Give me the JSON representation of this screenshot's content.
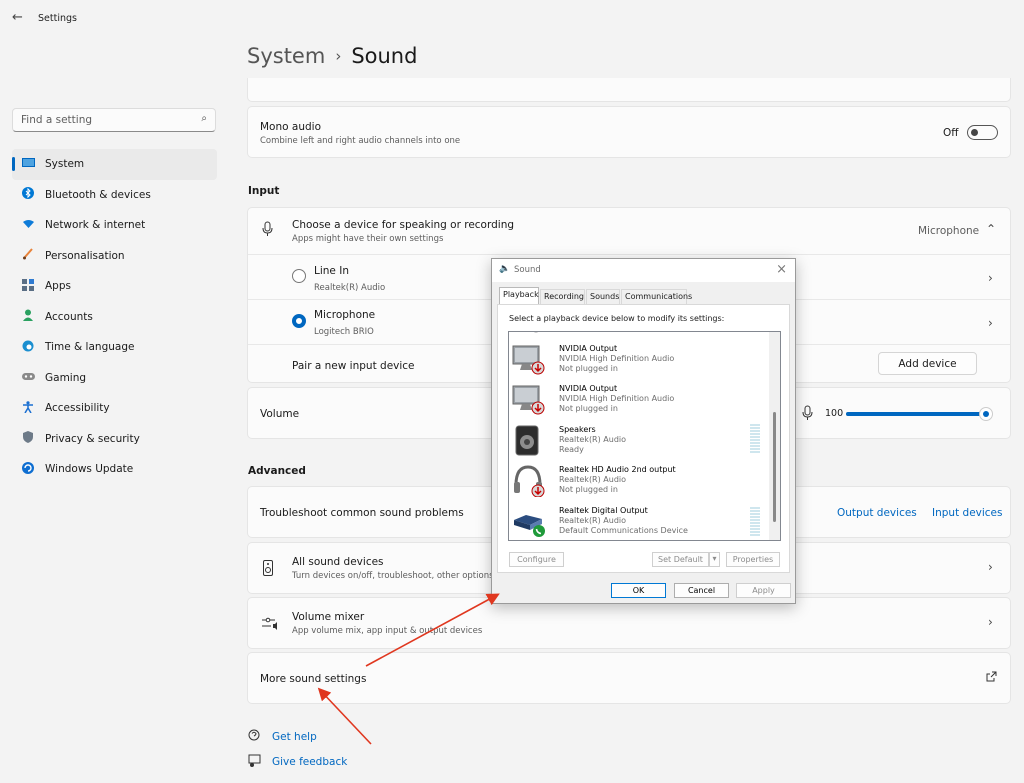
{
  "window": {
    "title": "Settings",
    "back_icon": "←"
  },
  "search": {
    "placeholder": "Find a setting",
    "icon": "search-icon"
  },
  "sidebar": {
    "items": [
      {
        "label": "System",
        "icon": "system-icon",
        "color": "#0067c0"
      },
      {
        "label": "Bluetooth & devices",
        "icon": "bluetooth-icon",
        "color": "#0078d4"
      },
      {
        "label": "Network & internet",
        "icon": "wifi-icon",
        "color": "#0e7bd8"
      },
      {
        "label": "Personalisation",
        "icon": "brush-icon",
        "color": "#e8833a"
      },
      {
        "label": "Apps",
        "icon": "apps-icon",
        "color": "#5a6e84"
      },
      {
        "label": "Accounts",
        "icon": "person-icon",
        "color": "#2aa160"
      },
      {
        "label": "Time & language",
        "icon": "globe-icon",
        "color": "#1b8fd0"
      },
      {
        "label": "Gaming",
        "icon": "gamepad-icon",
        "color": "#7a7a7a"
      },
      {
        "label": "Accessibility",
        "icon": "accessibility-icon",
        "color": "#1a6fd1"
      },
      {
        "label": "Privacy & security",
        "icon": "shield-icon",
        "color": "#6d7a88"
      },
      {
        "label": "Windows Update",
        "icon": "update-icon",
        "color": "#0e6ed1"
      }
    ]
  },
  "breadcrumb": {
    "parent": "System",
    "separator": "›",
    "current": "Sound"
  },
  "mono": {
    "title": "Mono audio",
    "subtitle": "Combine left and right audio channels into one",
    "state": "Off"
  },
  "input": {
    "heading": "Input",
    "choose_title": "Choose a device for speaking or recording",
    "choose_sub": "Apps might have their own settings",
    "selected_device": "Microphone",
    "devices": [
      {
        "name": "Line In",
        "detail": "Realtek(R) Audio",
        "selected": false
      },
      {
        "name": "Microphone",
        "detail": "Logitech BRIO",
        "selected": true
      }
    ],
    "pair_label": "Pair a new input device",
    "add_button": "Add device",
    "volume_label": "Volume",
    "volume_value": "100",
    "volume_level": 1.0
  },
  "advanced": {
    "heading": "Advanced",
    "troubleshoot": "Troubleshoot common sound problems",
    "output_link": "Output devices",
    "input_link": "Input devices",
    "all_devices_title": "All sound devices",
    "all_devices_sub": "Turn devices on/off, troubleshoot, other options",
    "mixer_title": "Volume mixer",
    "mixer_sub": "App volume mix, app input & output devices",
    "more_settings": "More sound settings"
  },
  "footer": {
    "help": "Get help",
    "feedback": "Give feedback"
  },
  "dialog": {
    "title": "Sound",
    "tabs": [
      "Playback",
      "Recording",
      "Sounds",
      "Communications"
    ],
    "hint": "Select a playback device below to modify its settings:",
    "devices": [
      {
        "name": "NVIDIA Output",
        "detail": "NVIDIA High Definition Audio",
        "status": "Not plugged in",
        "kind": "monitor",
        "badge": "down"
      },
      {
        "name": "NVIDIA Output",
        "detail": "NVIDIA High Definition Audio",
        "status": "Not plugged in",
        "kind": "monitor",
        "badge": "down"
      },
      {
        "name": "Speakers",
        "detail": "Realtek(R) Audio",
        "status": "Ready",
        "kind": "speaker",
        "badge": ""
      },
      {
        "name": "Realtek HD Audio 2nd output",
        "detail": "Realtek(R) Audio",
        "status": "Not plugged in",
        "kind": "headphones",
        "badge": "down"
      },
      {
        "name": "Realtek Digital Output",
        "detail": "Realtek(R) Audio",
        "status": "Default Communications Device",
        "kind": "digital",
        "badge": "phone"
      }
    ],
    "configure": "Configure",
    "set_default": "Set Default",
    "properties": "Properties",
    "ok": "OK",
    "cancel": "Cancel",
    "apply": "Apply"
  },
  "colors": {
    "accent": "#0067c0",
    "annotation_arrow": "#e0371f"
  }
}
